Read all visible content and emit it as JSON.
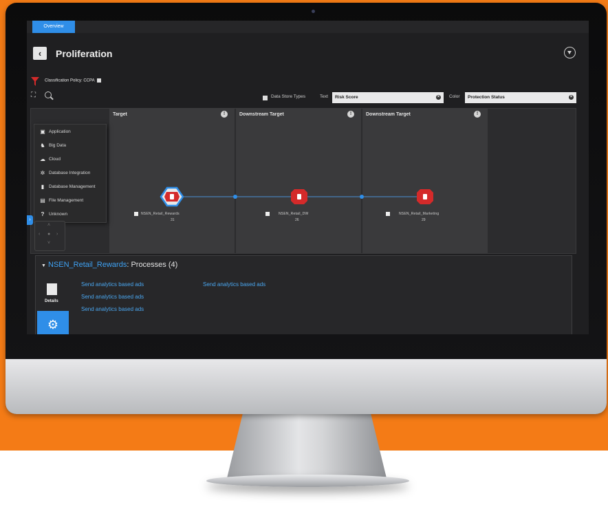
{
  "tabs": {
    "overview": "Overview"
  },
  "page": {
    "title": "Proliferation"
  },
  "filter": {
    "classification_policy": "Classification Policy: CCPA"
  },
  "toolbar": {
    "data_store_types": "Data Store Types",
    "text_label": "Text",
    "text_value": "Risk Score",
    "color_label": "Color",
    "color_value": "Protection Status"
  },
  "columns": [
    {
      "title": "Target"
    },
    {
      "title": "Downstream Target"
    },
    {
      "title": "Downstream Target"
    }
  ],
  "data_store_types": [
    {
      "label": "Application",
      "icon": "application-icon"
    },
    {
      "label": "Big Data",
      "icon": "elephant-icon"
    },
    {
      "label": "Cloud",
      "icon": "cloud-icon"
    },
    {
      "label": "Database Integration",
      "icon": "integration-icon"
    },
    {
      "label": "Database Management",
      "icon": "database-icon"
    },
    {
      "label": "File Management",
      "icon": "file-icon"
    },
    {
      "label": "Unknown",
      "icon": "question-icon"
    }
  ],
  "nodes": [
    {
      "label": "NSEN_Retail_Rewards",
      "score": "31",
      "selected": true
    },
    {
      "label": "NSEN_Retail_DW",
      "score": "26",
      "selected": false
    },
    {
      "label": "NSEN_Retail_Marketing",
      "score": "29",
      "selected": false
    }
  ],
  "processes": {
    "name": "NSEN_Retail_Rewards",
    "suffix": ": Processes (4)",
    "details_label": "Details",
    "items": [
      "Send analytics based ads",
      "Send analytics based ads",
      "Send analytics based ads",
      "Send analytics based ads"
    ]
  },
  "colors": {
    "accent": "#2f8ee8",
    "node_red": "#d42a2a",
    "selected_outline": "#2f8ee8",
    "background": "#f47b16"
  }
}
